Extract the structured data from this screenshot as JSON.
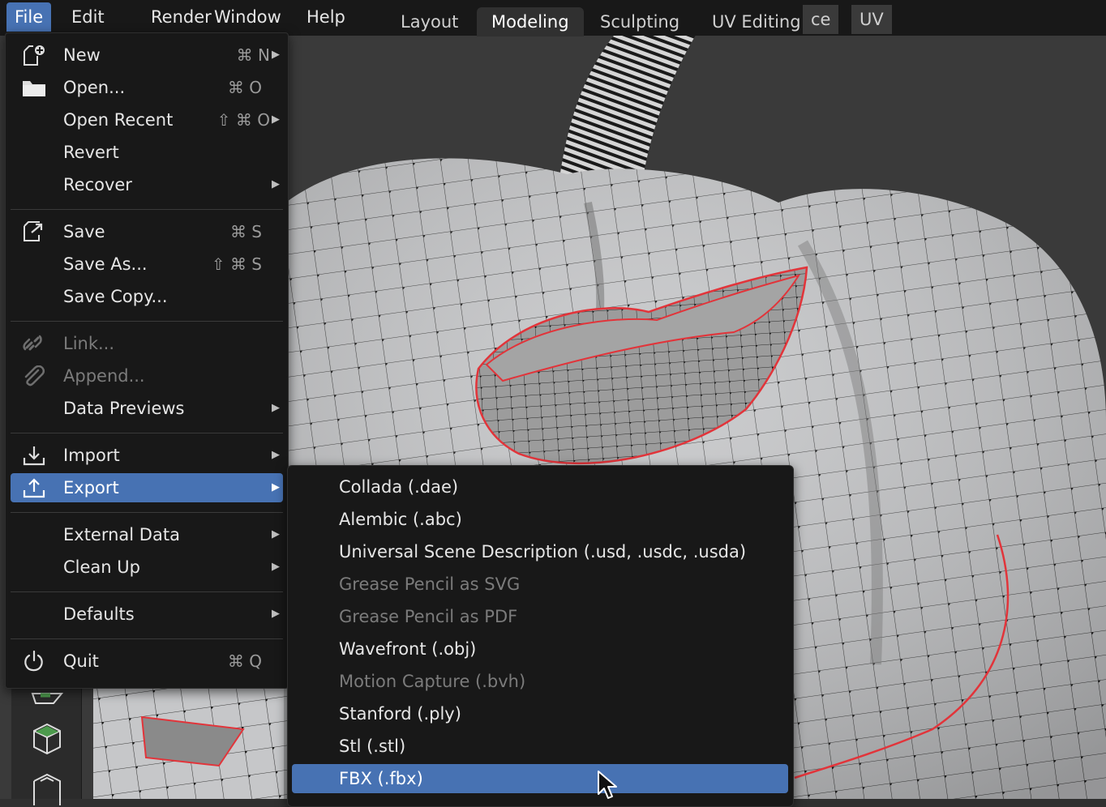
{
  "menubar": {
    "items": [
      {
        "label": "File",
        "active": true
      },
      {
        "label": "Edit"
      },
      {
        "label": "Render"
      },
      {
        "label": "Window"
      },
      {
        "label": "Help"
      }
    ],
    "workspace_tabs": [
      {
        "label": "Layout"
      },
      {
        "label": "Modeling",
        "active": true
      },
      {
        "label": "Sculpting"
      },
      {
        "label": "UV Editing"
      },
      {
        "label": "ce"
      },
      {
        "label": "UV"
      }
    ]
  },
  "file_menu": {
    "items": [
      {
        "label": "New",
        "shortcut": "⌘ N",
        "submenu": true,
        "icon": "new-file-icon"
      },
      {
        "label": "Open...",
        "shortcut": "⌘ O",
        "icon": "folder-icon"
      },
      {
        "label": "Open Recent",
        "shortcut": "⇧ ⌘ O",
        "submenu": true
      },
      {
        "label": "Revert"
      },
      {
        "label": "Recover",
        "submenu": true
      },
      {
        "label": "Save",
        "shortcut": "⌘ S",
        "icon": "save-icon"
      },
      {
        "label": "Save As...",
        "shortcut": "⇧ ⌘ S"
      },
      {
        "label": "Save Copy..."
      },
      {
        "label": "Link...",
        "disabled": true,
        "icon": "link-icon"
      },
      {
        "label": "Append...",
        "disabled": true,
        "icon": "paperclip-icon"
      },
      {
        "label": "Data Previews",
        "submenu": true
      },
      {
        "label": "Import",
        "submenu": true,
        "icon": "import-icon"
      },
      {
        "label": "Export",
        "submenu": true,
        "highlighted": true,
        "icon": "export-icon"
      },
      {
        "label": "External Data",
        "submenu": true
      },
      {
        "label": "Clean Up",
        "submenu": true
      },
      {
        "label": "Defaults",
        "submenu": true
      },
      {
        "label": "Quit",
        "shortcut": "⌘ Q",
        "icon": "power-icon"
      }
    ]
  },
  "export_menu": {
    "items": [
      {
        "label": "Collada (.dae)"
      },
      {
        "label": "Alembic (.abc)"
      },
      {
        "label": "Universal Scene Description (.usd, .usdc, .usda)"
      },
      {
        "label": "Grease Pencil as SVG",
        "disabled": true
      },
      {
        "label": "Grease Pencil as PDF",
        "disabled": true
      },
      {
        "label": "Wavefront (.obj)"
      },
      {
        "label": "Motion Capture (.bvh)",
        "disabled": true
      },
      {
        "label": "Stanford (.ply)"
      },
      {
        "label": "Stl (.stl)"
      },
      {
        "label": "FBX (.fbx)",
        "highlighted": true
      }
    ]
  },
  "colors": {
    "accent": "#4772b3",
    "menu_bg": "#181818",
    "viewport_bg": "#303030",
    "mesh_face": "#c8c9cb",
    "seam": "#e2343a"
  },
  "cursor_icon": "arrow-cursor-icon"
}
